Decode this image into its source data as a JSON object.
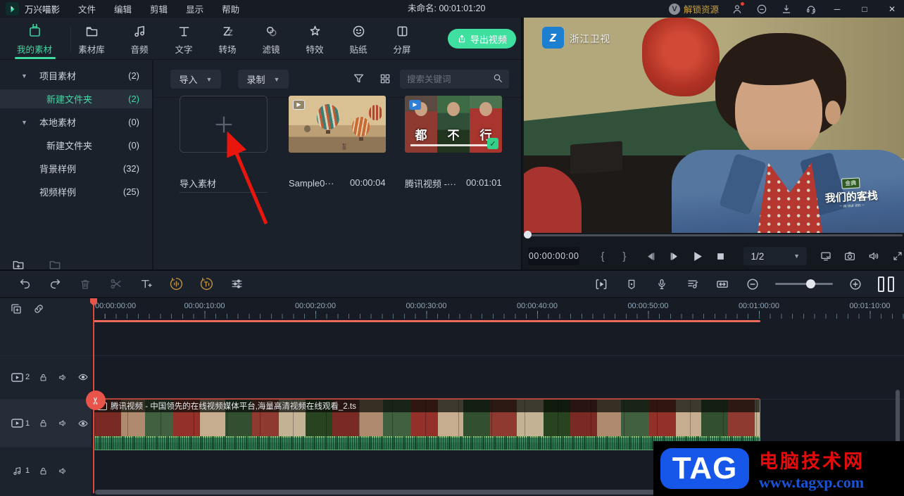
{
  "titlebar": {
    "app_name": "万兴喵影",
    "menus": [
      "文件",
      "编辑",
      "剪辑",
      "显示",
      "帮助"
    ],
    "project_title": "未命名: 00:01:01:20",
    "unlock_label": "解锁资源",
    "unlock_badge": "V",
    "minimize": "─",
    "maximize": "□",
    "close": "✕"
  },
  "tabs": {
    "export_label": "导出视频",
    "items": [
      {
        "label": "我的素材"
      },
      {
        "label": "素材库"
      },
      {
        "label": "音频"
      },
      {
        "label": "文字"
      },
      {
        "label": "转场"
      },
      {
        "label": "滤镜"
      },
      {
        "label": "特效"
      },
      {
        "label": "贴纸"
      },
      {
        "label": "分屏"
      }
    ]
  },
  "sidebar": {
    "items": [
      {
        "label": "项目素材",
        "count": "(2)"
      },
      {
        "label": "新建文件夹",
        "count": "(2)"
      },
      {
        "label": "本地素材",
        "count": "(0)"
      },
      {
        "label": "新建文件夹",
        "count": "(0)"
      },
      {
        "label": "背景样例",
        "count": "(32)"
      },
      {
        "label": "视频样例",
        "count": "(25)"
      }
    ]
  },
  "media": {
    "import_button": "导入",
    "record_button": "录制",
    "search_placeholder": "搜索关键词",
    "items": [
      {
        "label": "导入素材"
      },
      {
        "label": "Sample0···",
        "duration": "00:00:04"
      },
      {
        "label": "腾讯视频 -···",
        "duration": "00:01:01",
        "overlay_chars": [
          "都",
          "不",
          "行"
        ]
      }
    ]
  },
  "preview": {
    "channel_logo": "浙江卫视",
    "channel_logo_glyph": "z",
    "watermark_brand": "金典",
    "watermark_title": "我们的客栈",
    "watermark_sub": "~ at our inn ~",
    "timecode": "00:00:00:00",
    "mark_in": "{",
    "mark_out": "}",
    "quality": "1/2"
  },
  "timeline": {
    "ruler_labels": [
      "00:00:00:00",
      "00:00:10:00",
      "00:00:20:00",
      "00:00:30:00",
      "00:00:40:00",
      "00:00:50:00",
      "00:01:00:00",
      "00:01:10:00"
    ],
    "clip_name": "腾讯视频 - 中国领先的在线视频媒体平台,海量高清视频在线观看_2.ts",
    "tracks": [
      {
        "label": "2"
      },
      {
        "label": "1"
      },
      {
        "label": "1"
      }
    ]
  },
  "watermark": {
    "tag": "TAG",
    "site": "电脑技术网",
    "url": "www.tagxp.com"
  },
  "colors": {
    "accent_teal": "#3fd9a2",
    "export_green": "#3fdf9f",
    "gold": "#c9973f",
    "playhead_red": "#e8544a",
    "rendered_line_red": "#ee6a5b",
    "waveform_green": "#2e7a50",
    "tag_blue": "#1656e8",
    "tag_red": "#e20c0c"
  }
}
